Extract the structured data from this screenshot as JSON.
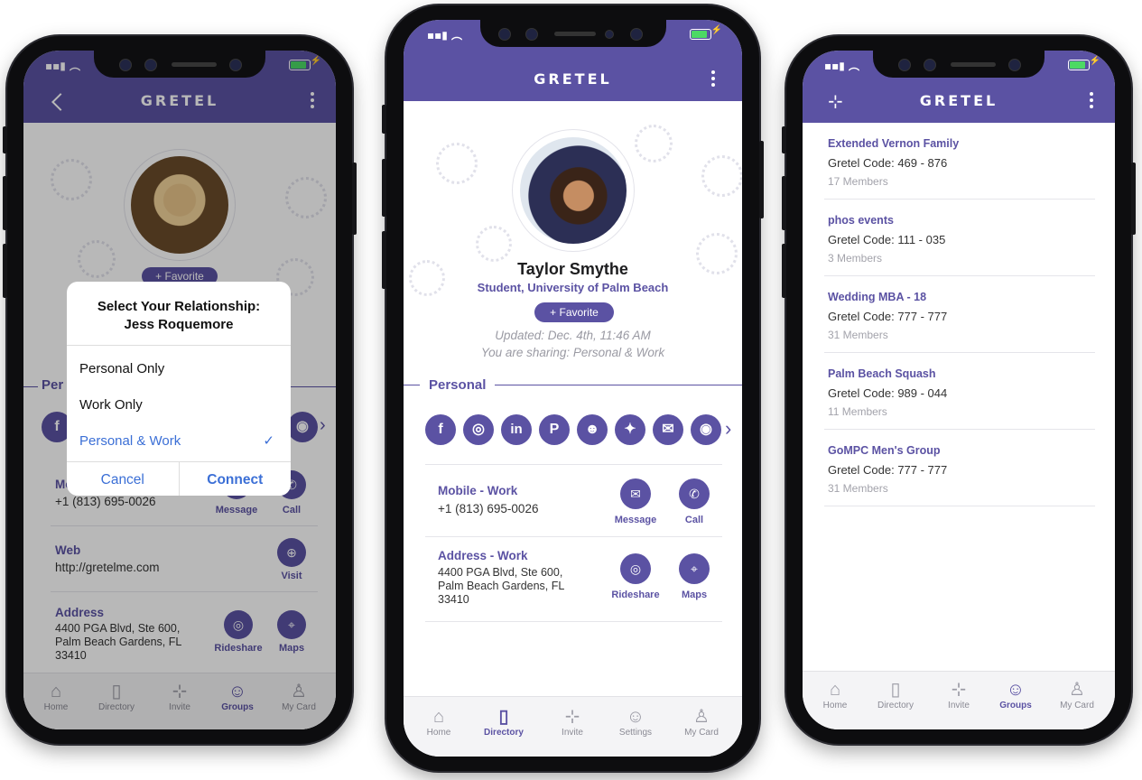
{
  "brand": {
    "logo": "GRETEL",
    "accent": "#5b52a3",
    "link_blue": "#3b6fd6",
    "battery_green": "#4cd964"
  },
  "phone1": {
    "favorite_label": "+ Favorite",
    "dialog": {
      "title_line1": "Select Your Relationship:",
      "title_line2": "Jess Roquemore",
      "options": [
        "Personal Only",
        "Work Only",
        "Personal & Work"
      ],
      "selected": "Personal & Work",
      "cancel": "Cancel",
      "connect": "Connect"
    },
    "section_title": "Per",
    "mobile": {
      "title": "Mo",
      "number": "+1 (813) 695-0026",
      "message": "Message",
      "call": "Call"
    },
    "web": {
      "title": "Web",
      "url": "http://gretelme.com",
      "visit": "Visit"
    },
    "address": {
      "title": "Address",
      "line1": "4400 PGA Blvd, Ste 600,",
      "line2": "Palm Beach Gardens, FL",
      "line3": "33410",
      "rideshare": "Rideshare",
      "maps": "Maps"
    },
    "tabs": [
      {
        "label": "Home",
        "icon": "home-icon"
      },
      {
        "label": "Directory",
        "icon": "directory-icon"
      },
      {
        "label": "Invite",
        "icon": "invite-icon"
      },
      {
        "label": "Groups",
        "icon": "groups-icon"
      },
      {
        "label": "My Card",
        "icon": "my-card-icon"
      }
    ],
    "active_tab": "Groups"
  },
  "phone2": {
    "name": "Taylor Smythe",
    "subtitle": "Student, University of Palm Beach",
    "favorite_label": "+ Favorite",
    "updated": "Updated: Dec. 4th, 11:46 AM",
    "sharing": "You are sharing: Personal & Work",
    "section_title": "Personal",
    "social": [
      {
        "icon": "facebook-icon",
        "glyph": "f"
      },
      {
        "icon": "instagram-icon",
        "glyph": "◎"
      },
      {
        "icon": "linkedin-icon",
        "glyph": "in"
      },
      {
        "icon": "pinterest-icon",
        "glyph": "P"
      },
      {
        "icon": "reddit-icon",
        "glyph": "☻"
      },
      {
        "icon": "twitter-icon",
        "glyph": "✦"
      },
      {
        "icon": "wechat-icon",
        "glyph": "✉"
      },
      {
        "icon": "weibo-icon",
        "glyph": "◉"
      }
    ],
    "mobile": {
      "title": "Mobile - Work",
      "number": "+1 (813) 695-0026",
      "message": "Message",
      "call": "Call"
    },
    "address": {
      "title": "Address - Work",
      "line1": "4400 PGA Blvd, Ste 600,",
      "line2": "Palm Beach Gardens, FL",
      "line3": "33410",
      "rideshare": "Rideshare",
      "maps": "Maps"
    },
    "tabs": [
      {
        "label": "Home",
        "icon": "home-icon"
      },
      {
        "label": "Directory",
        "icon": "directory-icon"
      },
      {
        "label": "Invite",
        "icon": "invite-icon"
      },
      {
        "label": "Settings",
        "icon": "settings-icon"
      },
      {
        "label": "My Card",
        "icon": "my-card-icon"
      }
    ],
    "active_tab": "Directory"
  },
  "phone3": {
    "groups": [
      {
        "name": "Extended Vernon Family",
        "code": "Gretel Code: 469 - 876",
        "members": "17 Members"
      },
      {
        "name": "phos events",
        "code": "Gretel Code: 111 - 035",
        "members": "3 Members"
      },
      {
        "name": "Wedding MBA - 18",
        "code": "Gretel Code: 777 - 777",
        "members": "31 Members"
      },
      {
        "name": "Palm Beach Squash",
        "code": "Gretel Code: 989 - 044",
        "members": "11 Members"
      },
      {
        "name": "GoMPC Men's Group",
        "code": "Gretel Code: 777 - 777",
        "members": "31 Members"
      }
    ],
    "tabs": [
      {
        "label": "Home",
        "icon": "home-icon"
      },
      {
        "label": "Directory",
        "icon": "directory-icon"
      },
      {
        "label": "Invite",
        "icon": "invite-icon"
      },
      {
        "label": "Groups",
        "icon": "groups-icon"
      },
      {
        "label": "My Card",
        "icon": "my-card-icon"
      }
    ],
    "active_tab": "Groups"
  }
}
